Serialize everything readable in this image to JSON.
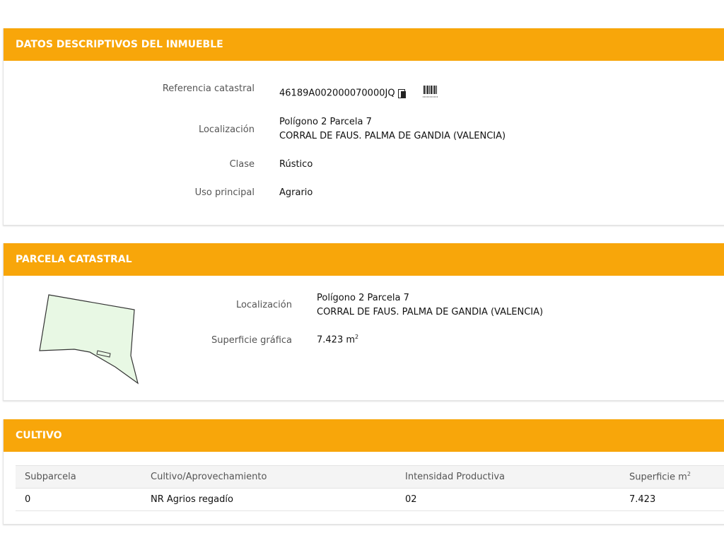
{
  "datos": {
    "title": "DATOS DESCRIPTIVOS DEL INMUEBLE",
    "referencia_label": "Referencia catastral",
    "referencia_value": "46189A002000070000JQ",
    "localizacion_label": "Localización",
    "localizacion_line1": "Polígono 2 Parcela 7",
    "localizacion_line2": "CORRAL DE FAUS. PALMA DE GANDIA (VALENCIA)",
    "clase_label": "Clase",
    "clase_value": "Rústico",
    "uso_label": "Uso principal",
    "uso_value": "Agrario"
  },
  "parcela": {
    "title": "PARCELA CATASTRAL",
    "localizacion_label": "Localización",
    "localizacion_line1": "Polígono 2 Parcela 7",
    "localizacion_line2": "CORRAL DE FAUS. PALMA DE GANDIA (VALENCIA)",
    "superficie_label": "Superficie gráfica",
    "superficie_value": "7.423 m",
    "superficie_exp": "2"
  },
  "cultivo": {
    "title": "CULTIVO",
    "headers": {
      "subparcela": "Subparcela",
      "cultivo": "Cultivo/Aprovechamiento",
      "intensidad": "Intensidad Productiva",
      "superficie": "Superficie m",
      "superficie_exp": "2"
    },
    "rows": [
      {
        "subparcela": "0",
        "cultivo": "NR Agrios regadío",
        "intensidad": "02",
        "superficie": "7.423"
      }
    ]
  },
  "colors": {
    "header_bg": "#f8a60a",
    "parcel_fill": "#e8f8e4"
  },
  "icons": {
    "copy": "copy-icon",
    "barcode": "barcode-icon"
  }
}
